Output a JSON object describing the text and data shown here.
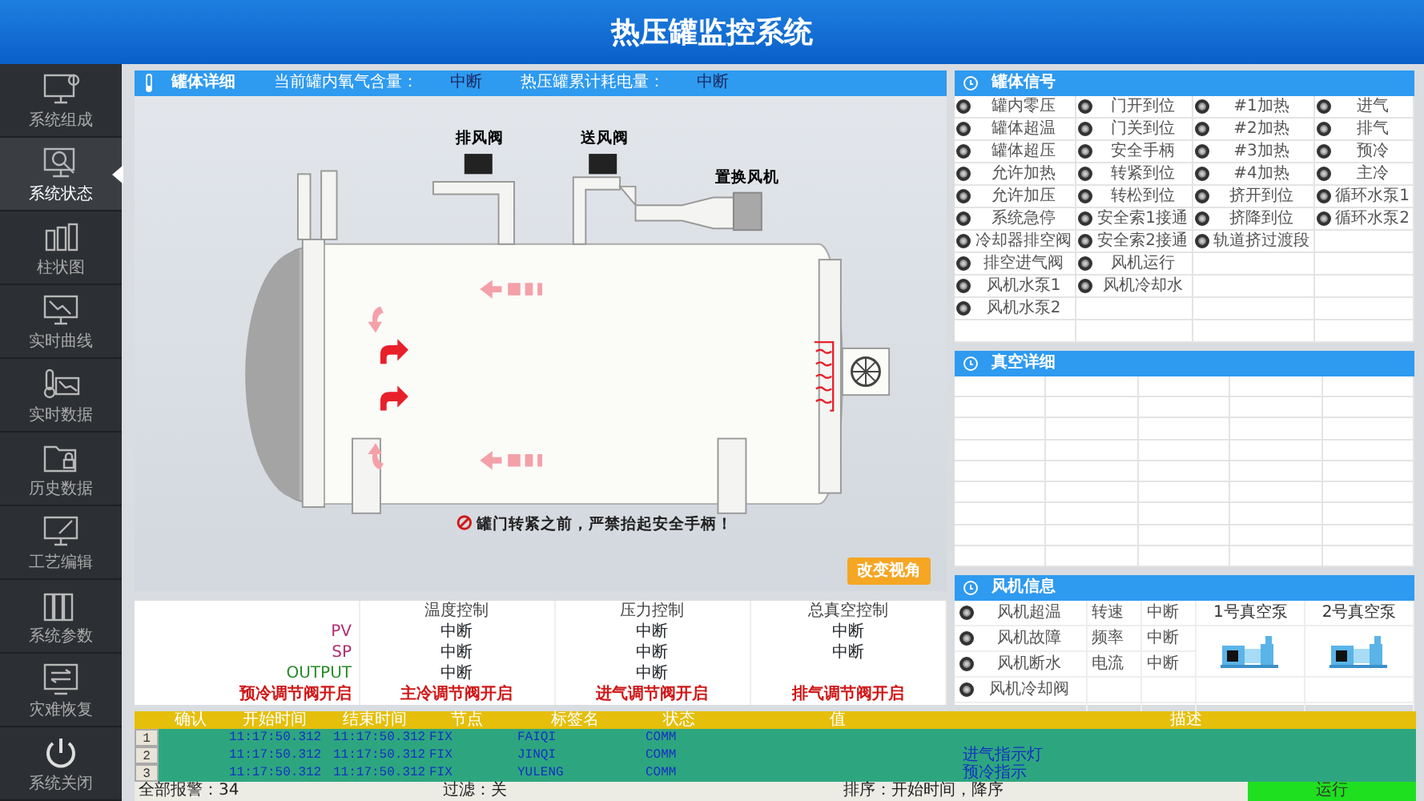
{
  "window": {
    "title": "热压罐监控系统"
  },
  "sidebar": {
    "items": [
      {
        "label": "系统组成",
        "selected": false
      },
      {
        "label": "系统状态",
        "selected": true
      },
      {
        "label": "柱状图",
        "selected": false
      },
      {
        "label": "实时曲线",
        "selected": false
      },
      {
        "label": "实时数据",
        "selected": false
      },
      {
        "label": "历史数据",
        "selected": false
      },
      {
        "label": "工艺编辑",
        "selected": false
      },
      {
        "label": "系统参数",
        "selected": false
      },
      {
        "label": "灾难恢复",
        "selected": false
      },
      {
        "label": "系统关闭",
        "selected": false
      }
    ]
  },
  "tank_panel": {
    "title": "罐体详细",
    "fields": [
      {
        "label": "当前罐内氧气含量：",
        "value": "中断"
      },
      {
        "label": "热压罐累计耗电量：",
        "value": "中断"
      }
    ],
    "drawing_labels": [
      "排风阀",
      "送风阀",
      "置换风机"
    ],
    "warning": "罐门转紧之前，严禁抬起安全手柄！",
    "view_button": "改变视角"
  },
  "control": {
    "columns": [
      "温度控制",
      "压力控制",
      "总真空控制"
    ],
    "rows": [
      {
        "label": "PV",
        "color": "#b03070",
        "values": [
          "中断",
          "中断",
          "中断"
        ]
      },
      {
        "label": "SP",
        "color": "#b03070",
        "values": [
          "中断",
          "中断",
          "中断"
        ]
      },
      {
        "label": "OUTPUT",
        "color": "#2a8a2a",
        "values": [
          "中断",
          "中断"
        ]
      }
    ],
    "valve_states": [
      "预冷调节阀开启",
      "主冷调节阀开启",
      "进气调节阀开启",
      "排气调节阀开启"
    ]
  },
  "signals": {
    "title": "罐体信号",
    "columns": [
      {
        "items": [
          {
            "label": "罐内零压",
            "on": false
          },
          {
            "label": "罐体超温",
            "on": false
          },
          {
            "label": "罐体超压",
            "on": false
          },
          {
            "label": "允许加热",
            "on": false
          },
          {
            "label": "允许加压",
            "on": false
          },
          {
            "label": "系统急停",
            "on": false
          },
          {
            "label": "冷却器排空阀",
            "on": false
          },
          {
            "label": "排空进气阀",
            "on": false
          },
          {
            "label": "风机水泵1",
            "on": false
          },
          {
            "label": "风机水泵2",
            "on": false
          }
        ]
      },
      {
        "items": [
          {
            "label": "门开到位",
            "on": false
          },
          {
            "label": "门关到位",
            "on": false
          },
          {
            "label": "安全手柄",
            "on": false
          },
          {
            "label": "转紧到位",
            "on": false
          },
          {
            "label": "转松到位",
            "on": false
          },
          {
            "label": "安全索1接通",
            "on": false
          },
          {
            "label": "安全索2接通",
            "on": false
          },
          {
            "label": "风机运行",
            "on": false
          },
          {
            "label": "风机冷却水",
            "on": false
          }
        ]
      },
      {
        "items": [
          {
            "label": "#1加热",
            "on": false
          },
          {
            "label": "#2加热",
            "on": false
          },
          {
            "label": "#3加热",
            "on": false
          },
          {
            "label": "#4加热",
            "on": false
          },
          {
            "label": "挤开到位",
            "on": false
          },
          {
            "label": "挤降到位",
            "on": false
          },
          {
            "label": "轨道挤过渡段",
            "on": false
          }
        ]
      },
      {
        "items": [
          {
            "label": "进气",
            "on": false
          },
          {
            "label": "排气",
            "on": false
          },
          {
            "label": "预冷",
            "on": false
          },
          {
            "label": "主冷",
            "on": false
          },
          {
            "label": "循环水泵1",
            "on": false
          },
          {
            "label": "循环水泵2",
            "on": false
          }
        ]
      }
    ]
  },
  "vacuum_panel": {
    "title": "真空详细"
  },
  "fan_panel": {
    "title": "风机信息",
    "alarms": [
      {
        "label": "风机超温",
        "on": false
      },
      {
        "label": "风机故障",
        "on": false
      },
      {
        "label": "风机断水",
        "on": false
      },
      {
        "label": "风机冷却阀",
        "on": false
      }
    ],
    "readings": [
      {
        "label": "转速",
        "value": "中断"
      },
      {
        "label": "频率",
        "value": "中断"
      },
      {
        "label": "电流",
        "value": "中断"
      }
    ],
    "pumps": [
      "1号真空泵",
      "2号真空泵"
    ]
  },
  "alarm_table": {
    "columns": [
      "确认",
      "开始时间",
      "结束时间",
      "节点",
      "标签名",
      "状态",
      "值",
      "描述"
    ],
    "rows": [
      {
        "index": "1",
        "start": "11:17:50.312",
        "end": "11:17:50.312",
        "node": "FIX",
        "tag": "FAIQI",
        "status": "COMM"
      },
      {
        "index": "2",
        "start": "11:17:50.312",
        "end": "11:17:50.312",
        "node": "FIX",
        "tag": "JINQI",
        "status": "COMM",
        "description": "进气指示灯"
      },
      {
        "index": "3",
        "start": "11:17:50.312",
        "end": "11:17:50.312",
        "node": "FIX",
        "tag": "YULENG",
        "status": "COMM",
        "description": "预冷指示"
      }
    ],
    "footer": {
      "total": "全部报警：34",
      "filter": "过滤：关",
      "sort": "排序：开始时间，降序",
      "state": "运行"
    }
  }
}
